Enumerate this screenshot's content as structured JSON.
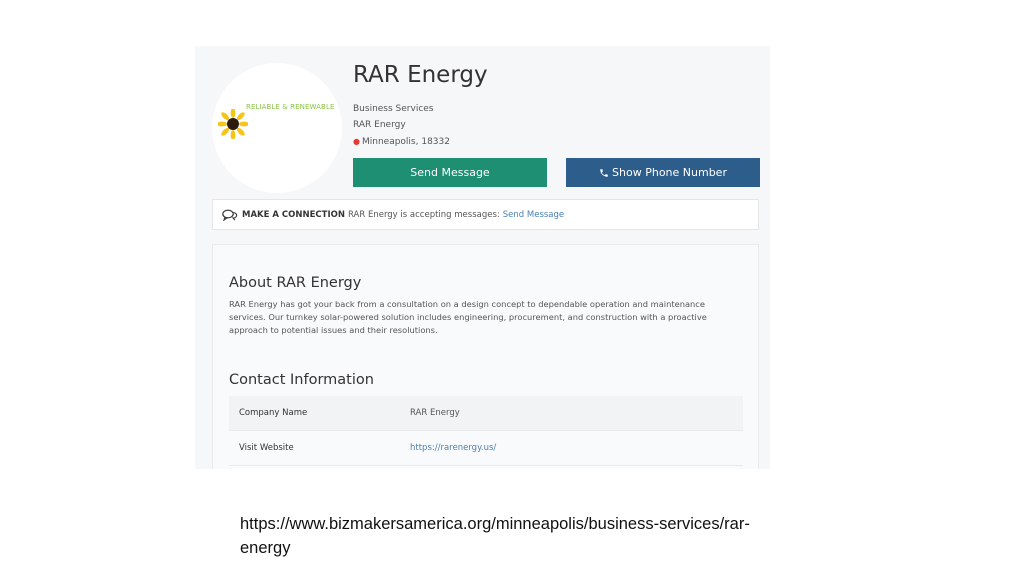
{
  "profile": {
    "logo_tagline": "RELIABLE & RENEWABLE",
    "logo_icon": "sunflower-icon",
    "name": "RAR Energy",
    "category": "Business Services",
    "company": "RAR Energy",
    "location_icon": "map-pin-icon",
    "location": "Minneapolis, 18332"
  },
  "actions": {
    "send_message": "Send Message",
    "show_phone": "Show Phone Number",
    "phone_icon": "phone-icon"
  },
  "connection": {
    "icon": "chat-bubbles-icon",
    "heading": "MAKE A CONNECTION",
    "text": "RAR Energy is accepting messages:",
    "link": "Send Message"
  },
  "about": {
    "title": "About RAR Energy",
    "text": "RAR Energy has got your back from a consultation on a design concept to dependable operation and maintenance services. Our turnkey solar-powered solution includes engineering, procurement, and construction with a proactive approach to potential issues and their resolutions."
  },
  "contact": {
    "title": "Contact Information",
    "rows": [
      {
        "label": "Company Name",
        "value": "RAR Energy"
      },
      {
        "label": "Visit Website",
        "value": "https://rarenergy.us/"
      }
    ]
  },
  "caption": "https://www.bizmakersamerica.org/minneapolis/business-services/rar-energy",
  "colors": {
    "send_button": "#1e8f73",
    "phone_button": "#2d5d8a",
    "link": "#4a7fb5",
    "pin": "#e53935",
    "tagline": "#8bc34a"
  }
}
